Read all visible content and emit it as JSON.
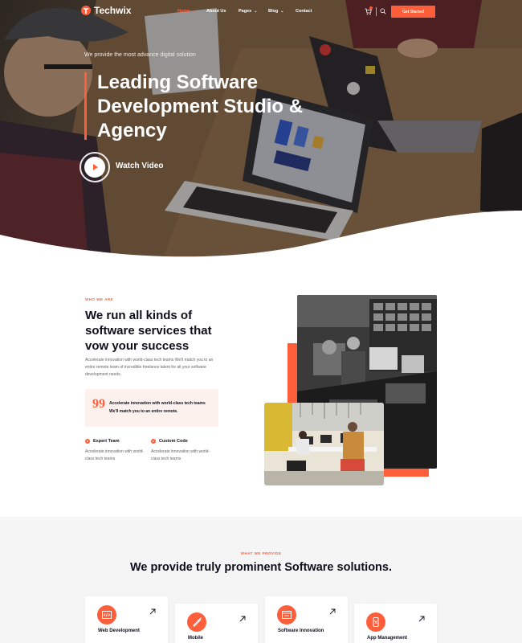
{
  "brand": {
    "name": "Techwix",
    "accent": "#ff5e3a"
  },
  "nav": {
    "items": [
      {
        "label": "Home",
        "dropdown": true,
        "active": true
      },
      {
        "label": "About Us",
        "dropdown": false
      },
      {
        "label": "Pages",
        "dropdown": true
      },
      {
        "label": "Blog",
        "dropdown": true
      },
      {
        "label": "Contact",
        "dropdown": false
      }
    ],
    "cta": "Get Started",
    "icons": [
      "cart-icon",
      "search-icon"
    ]
  },
  "hero": {
    "tagline": "We provide the most advance digital solution",
    "title": "Leading Software Development Studio & Agency",
    "video_label": "Watch Video"
  },
  "about": {
    "subtitle": "WHO WE ARE",
    "title": "We run all kinds of software services that vow your success",
    "description": "Accelerate innovation with world-class tech teams We'll match you to an entire remote team of incredible freelance talent for all your software development needs.",
    "quote": "Accelerate innovation with world-class tech teams We'll match you to an entire remote.",
    "features": [
      {
        "title": "Expert Team",
        "description": "Accelerate innovation with world-class tech teams"
      },
      {
        "title": "Custom Code",
        "description": "Accelerate innovation with world-class tech teams"
      }
    ]
  },
  "services": {
    "subtitle": "WHAT WE PROVIDE",
    "title": "We provide truly prominent Software solutions.",
    "cards": [
      {
        "title": "Web Development",
        "icon": "code-icon"
      },
      {
        "title": "Mobile",
        "icon": "rocket-icon"
      },
      {
        "title": "Software Innovation",
        "icon": "browser-icon"
      },
      {
        "title": "App Management",
        "icon": "phone-icon"
      }
    ]
  }
}
